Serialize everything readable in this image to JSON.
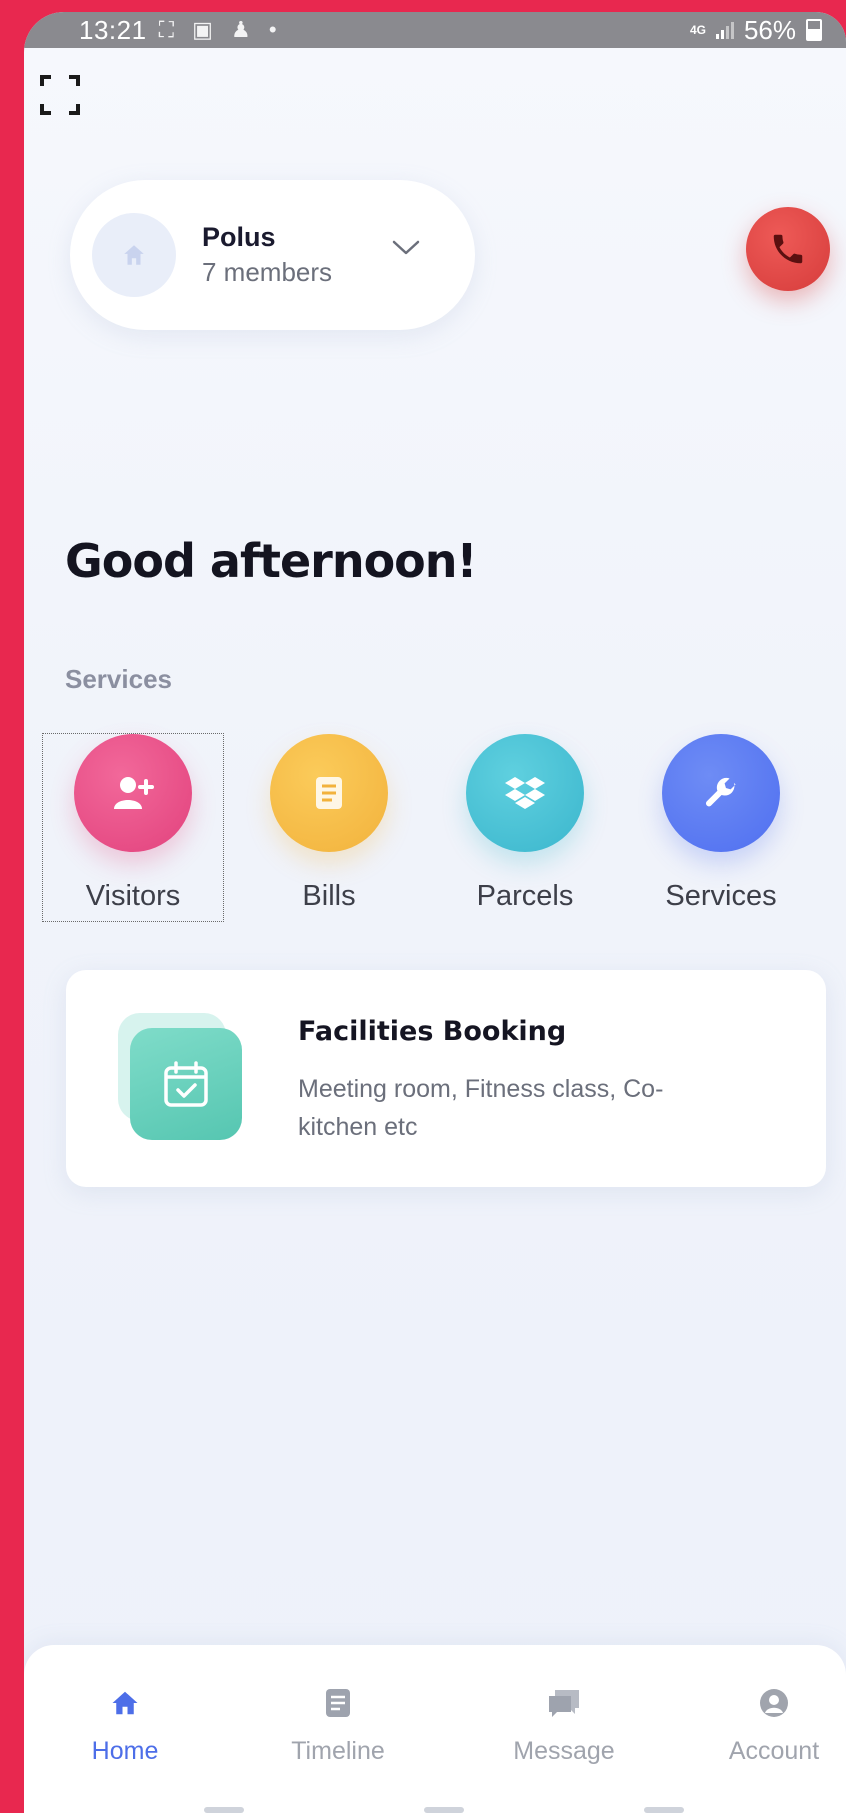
{
  "status_bar": {
    "time": "13:21",
    "network": "4G",
    "battery": "56%"
  },
  "community": {
    "name": "Polus",
    "members": "7 members"
  },
  "greeting": "Good afternoon!",
  "services": {
    "section_label": "Services",
    "items": [
      {
        "label": "Visitors",
        "icon": "add-user-icon",
        "color": "#e2427d"
      },
      {
        "label": "Bills",
        "icon": "document-icon",
        "color": "#f2b23c"
      },
      {
        "label": "Parcels",
        "icon": "box-icon",
        "color": "#3bb6cd"
      },
      {
        "label": "Services",
        "icon": "wrench-icon",
        "color": "#4f6ff0"
      }
    ]
  },
  "facilities": {
    "title": "Facilities Booking",
    "description": "Meeting room, Fitness class, Co-kitchen etc",
    "icon": "calendar-check-icon"
  },
  "tabbar": {
    "items": [
      {
        "label": "Home",
        "icon": "home-icon",
        "active": true
      },
      {
        "label": "Timeline",
        "icon": "timeline-icon",
        "active": false
      },
      {
        "label": "Message",
        "icon": "message-icon",
        "active": false
      },
      {
        "label": "Account",
        "icon": "account-icon",
        "active": false
      }
    ]
  },
  "colors": {
    "accent": "#4d6ee8",
    "call_button": "#d63c3b",
    "frame": "#e8284f"
  }
}
